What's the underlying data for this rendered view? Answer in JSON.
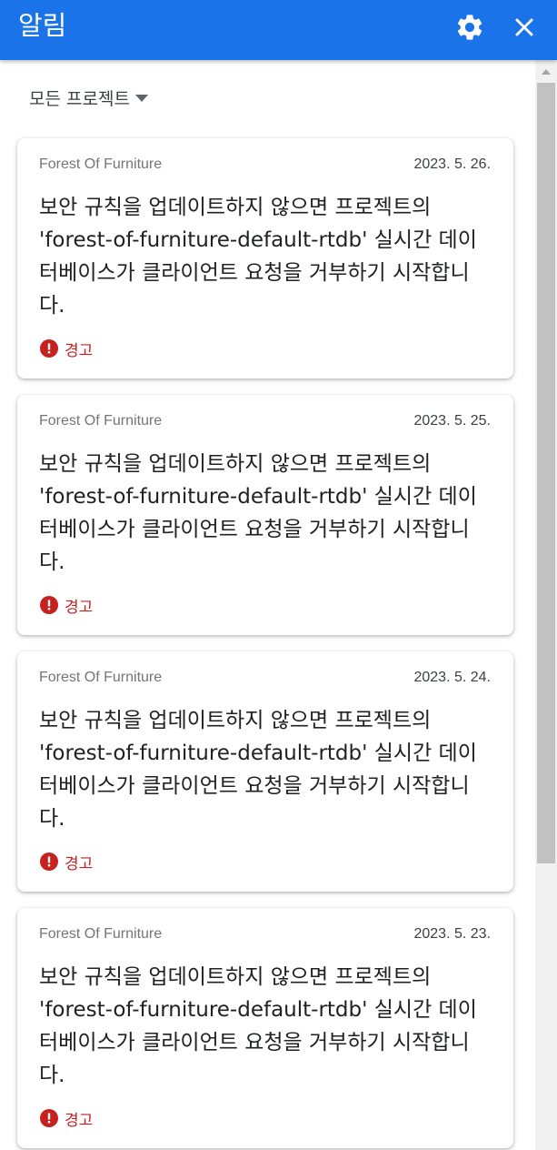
{
  "header": {
    "title": "알림",
    "settings_icon": "gear-icon",
    "close_icon": "close-icon",
    "background": "#1a73e8"
  },
  "filter": {
    "label": "모든 프로젝트",
    "icon": "caret-down-icon"
  },
  "notifications": [
    {
      "project": "Forest Of Furniture",
      "date": "2023. 5. 26.",
      "message": "보안 규칙을 업데이트하지 않으면 프로젝트의 'forest-of-furniture-default-rtdb' 실시간 데이터베이스가 클라이언트 요청을 거부하기 시작합니다.",
      "level": "경고"
    },
    {
      "project": "Forest Of Furniture",
      "date": "2023. 5. 25.",
      "message": "보안 규칙을 업데이트하지 않으면 프로젝트의 'forest-of-furniture-default-rtdb' 실시간 데이터베이스가 클라이언트 요청을 거부하기 시작합니다.",
      "level": "경고"
    },
    {
      "project": "Forest Of Furniture",
      "date": "2023. 5. 24.",
      "message": "보안 규칙을 업데이트하지 않으면 프로젝트의 'forest-of-furniture-default-rtdb' 실시간 데이터베이스가 클라이언트 요청을 거부하기 시작합니다.",
      "level": "경고"
    },
    {
      "project": "Forest Of Furniture",
      "date": "2023. 5. 23.",
      "message": "보안 규칙을 업데이트하지 않으면 프로젝트의 'forest-of-furniture-default-rtdb' 실시간 데이터베이스가 클라이언트 요청을 거부하기 시작합니다.",
      "level": "경고"
    }
  ],
  "colors": {
    "warning": "#c5221f",
    "project_text": "#757575"
  }
}
